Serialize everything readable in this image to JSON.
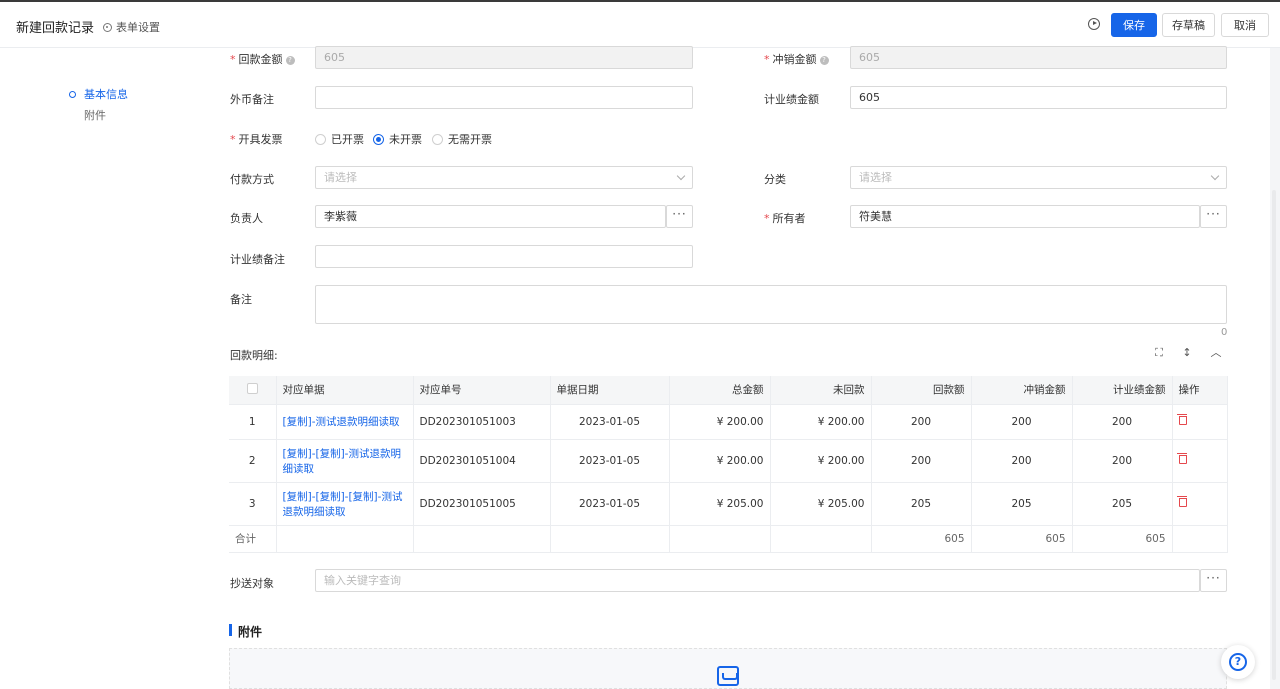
{
  "header": {
    "title": "新建回款记录",
    "form_settings": "表单设置",
    "save": "保存",
    "draft": "存草稿",
    "cancel": "取消"
  },
  "nav": {
    "basic_info": "基本信息",
    "attachments": "附件"
  },
  "form": {
    "payment_amount_label": "回款金额",
    "payment_amount_value": "605",
    "offset_amount_label": "冲销金额",
    "offset_amount_value": "605",
    "fx_note_label": "外币备注",
    "fx_note_value": "",
    "performance_amount_label": "计业绩金额",
    "performance_amount_value": "605",
    "invoice_label": "开具发票",
    "invoice_options": [
      "已开票",
      "未开票",
      "无需开票"
    ],
    "invoice_selected": "未开票",
    "payment_method_label": "付款方式",
    "payment_method_placeholder": "请选择",
    "category_label": "分类",
    "category_placeholder": "请选择",
    "owner_in_charge_label": "负责人",
    "owner_in_charge_value": "李紫薇",
    "owner_label": "所有者",
    "owner_value": "符美慧",
    "performance_note_label": "计业绩备注",
    "performance_note_value": "",
    "remark_label": "备注",
    "remark_count": "0"
  },
  "details": {
    "label": "回款明细:",
    "columns": [
      "对应单据",
      "对应单号",
      "单据日期",
      "总金额",
      "未回款",
      "回款额",
      "冲销金额",
      "计业绩金额",
      "操作"
    ],
    "rows": [
      {
        "index": "1",
        "doc": "[复制]-测试退款明细读取",
        "no": "DD202301051003",
        "date": "2023-01-05",
        "total": "¥ 200.00",
        "unpaid": "¥ 200.00",
        "paid": "200",
        "offset": "200",
        "perf": "200"
      },
      {
        "index": "2",
        "doc": "[复制]-[复制]-测试退款明细读取",
        "no": "DD202301051004",
        "date": "2023-01-05",
        "total": "¥ 200.00",
        "unpaid": "¥ 200.00",
        "paid": "200",
        "offset": "200",
        "perf": "200"
      },
      {
        "index": "3",
        "doc": "[复制]-[复制]-[复制]-测试退款明细读取",
        "no": "DD202301051005",
        "date": "2023-01-05",
        "total": "¥ 205.00",
        "unpaid": "¥ 205.00",
        "paid": "205",
        "offset": "205",
        "perf": "205"
      }
    ],
    "total_label": "合计",
    "total_paid": "605",
    "total_offset": "605",
    "total_perf": "605"
  },
  "cc": {
    "label": "抄送对象",
    "placeholder": "输入关键字查询"
  },
  "attachments_section": {
    "title": "附件"
  },
  "colors": {
    "primary": "#1665e8",
    "danger": "#e5484d"
  }
}
